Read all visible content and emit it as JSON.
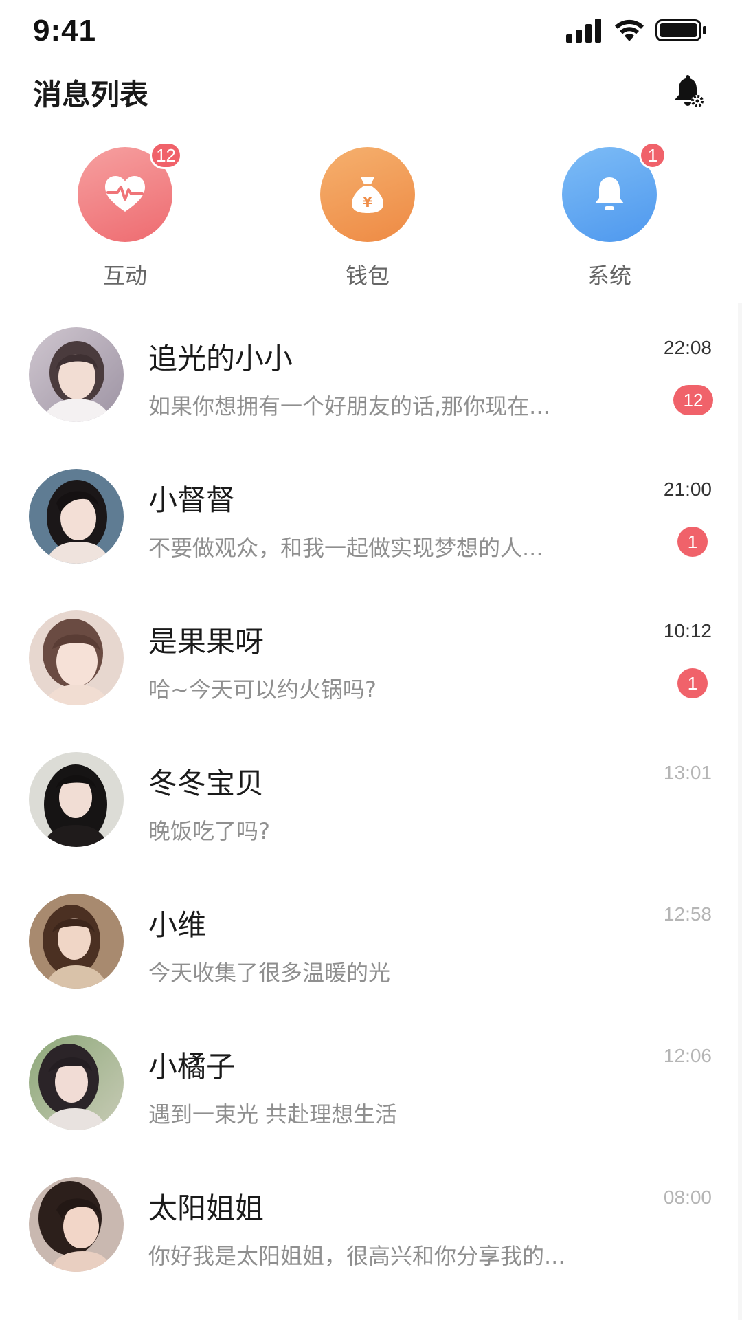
{
  "status_bar": {
    "time": "9:41",
    "icons": [
      "signal-icon",
      "wifi-icon",
      "battery-icon"
    ]
  },
  "header": {
    "title": "消息列表",
    "action_icon": "bell-settings-icon"
  },
  "quick_actions": [
    {
      "label": "互动",
      "icon": "heart-pulse-icon",
      "badge": "12",
      "color": "#f07b7f"
    },
    {
      "label": "钱包",
      "icon": "money-bag-icon",
      "badge": "",
      "color": "#f09a55"
    },
    {
      "label": "系统",
      "icon": "bell-icon",
      "badge": "1",
      "color": "#5fa8f2"
    }
  ],
  "chats": [
    {
      "name": "追光的小小",
      "preview": "如果你想拥有一个好朋友的话,那你现在...",
      "time": "22:08",
      "time_muted": false,
      "unread": "12"
    },
    {
      "name": "小督督",
      "preview": "不要做观众，和我一起做实现梦想的人...",
      "time": "21:00",
      "time_muted": false,
      "unread": "1"
    },
    {
      "name": "是果果呀",
      "preview": "哈~今天可以约火锅吗?",
      "time": "10:12",
      "time_muted": false,
      "unread": "1"
    },
    {
      "name": "冬冬宝贝",
      "preview": "晚饭吃了吗?",
      "time": "13:01",
      "time_muted": true,
      "unread": ""
    },
    {
      "name": "小维",
      "preview": "今天收集了很多温暖的光",
      "time": "12:58",
      "time_muted": true,
      "unread": ""
    },
    {
      "name": "小橘子",
      "preview": "遇到一束光 共赴理想生活",
      "time": "12:06",
      "time_muted": true,
      "unread": ""
    },
    {
      "name": "太阳姐姐",
      "preview": "你好我是太阳姐姐，很高兴和你分享我的...",
      "time": "08:00",
      "time_muted": true,
      "unread": ""
    }
  ],
  "colors": {
    "badge": "#f0626a",
    "primary_text": "#1a1a1a",
    "secondary_text": "#8f8f8f",
    "muted_time": "#b5b5b5"
  }
}
